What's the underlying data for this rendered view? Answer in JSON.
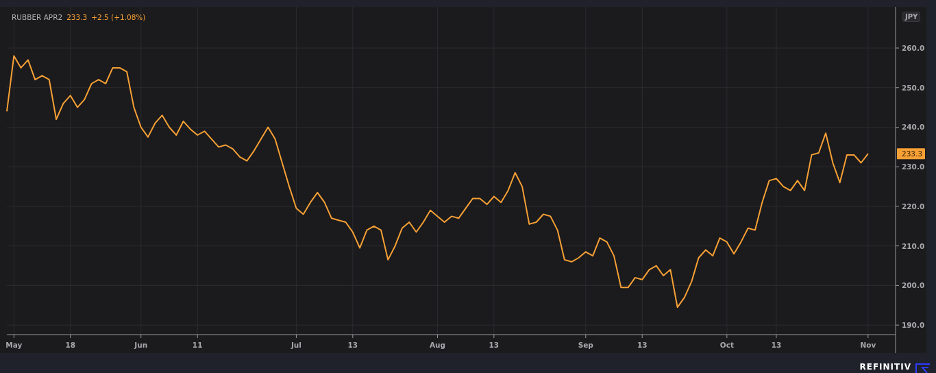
{
  "legend": {
    "last": "233.3",
    "change": "+2.5 (+1.08%)"
  },
  "currency": "JPY",
  "price_tag": "233.3",
  "chart": {
    "chart_data": {
      "type": "line",
      "grid": true,
      "categories": [
        null,
        "May",
        null,
        null,
        null,
        null,
        null,
        null,
        null,
        "18",
        null,
        null,
        null,
        null,
        null,
        null,
        null,
        null,
        null,
        "Jun",
        null,
        null,
        null,
        null,
        null,
        null,
        null,
        "11",
        null,
        null,
        null,
        null,
        null,
        null,
        null,
        null,
        null,
        null,
        null,
        null,
        null,
        "Jul",
        null,
        null,
        null,
        null,
        null,
        null,
        null,
        "13",
        null,
        null,
        null,
        null,
        null,
        null,
        null,
        null,
        null,
        null,
        null,
        "Aug",
        null,
        null,
        null,
        null,
        null,
        null,
        null,
        "13",
        null,
        null,
        null,
        null,
        null,
        null,
        null,
        null,
        null,
        null,
        null,
        null,
        "Sep",
        null,
        null,
        null,
        null,
        null,
        null,
        null,
        "13",
        null,
        null,
        null,
        null,
        null,
        null,
        null,
        null,
        null,
        null,
        null,
        "Oct",
        null,
        null,
        null,
        null,
        null,
        null,
        "13",
        null,
        null,
        null,
        null,
        null,
        null,
        null,
        null,
        null,
        null,
        null,
        null,
        "Nov"
      ],
      "ylim": [
        187.6,
        270.4
      ],
      "yticks": [
        {
          "value": 190,
          "label": "190.0"
        },
        {
          "value": 200,
          "label": "200.0"
        },
        {
          "value": 210,
          "label": "210.0"
        },
        {
          "value": 220,
          "label": "220.0"
        },
        {
          "value": 230,
          "label": "230.0"
        },
        {
          "value": 240,
          "label": "240.0"
        },
        {
          "value": 250,
          "label": "250.0"
        },
        {
          "value": 260,
          "label": "260.0"
        }
      ],
      "series": [
        {
          "name": "RUBBER APR2",
          "color": "#f7a035",
          "values": [
            244,
            258,
            255,
            257,
            252,
            253,
            252,
            242,
            246,
            248,
            245,
            247,
            251,
            252,
            251,
            255,
            255,
            254,
            245,
            240,
            237.5,
            241,
            243,
            240,
            238,
            241.5,
            239.5,
            238,
            239,
            237,
            235,
            235.5,
            234.5,
            232.5,
            231.5,
            234,
            237,
            240,
            237,
            231,
            225,
            219.5,
            218,
            221,
            223.5,
            221,
            217,
            216.5,
            216,
            213.5,
            209.5,
            214,
            215,
            214,
            206.5,
            210,
            214.5,
            216,
            213.5,
            216,
            219,
            217.5,
            216,
            217.5,
            217,
            219.5,
            222,
            222,
            220.5,
            222.5,
            221,
            224,
            228.5,
            225,
            215.5,
            216,
            218,
            217.5,
            214,
            206.5,
            206,
            207,
            208.5,
            207.5,
            212,
            211,
            207.5,
            199.5,
            199.5,
            202,
            201.5,
            204,
            205,
            202.5,
            204,
            194.5,
            197,
            201,
            207,
            209,
            207.5,
            212,
            211,
            208,
            211,
            214.5,
            214,
            221,
            226.5,
            227,
            225,
            224,
            226.5,
            224,
            233,
            233.5,
            238.5,
            231,
            226,
            233,
            233,
            231,
            233.3
          ]
        }
      ]
    }
  },
  "brand": "REFINITIV"
}
